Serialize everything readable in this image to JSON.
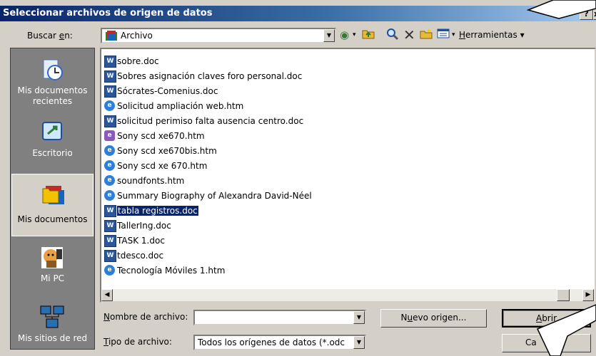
{
  "dialog": {
    "title": "Seleccionar archivos de origen de datos",
    "help_label": "?",
    "close_label": "x"
  },
  "lookin": {
    "label_pre": "Buscar ",
    "label_key": "e",
    "label_post": "n:",
    "value": "Archivo"
  },
  "toolbar": {
    "tools_key": "H",
    "tools_rest": "erramientas",
    "tools_arrow": "▾"
  },
  "places": [
    {
      "label": "Mis documentos recientes"
    },
    {
      "label": "Escritorio"
    },
    {
      "label": "Mis documentos"
    },
    {
      "label": "Mi PC"
    },
    {
      "label": "Mis sitios de red"
    }
  ],
  "files": [
    {
      "name": "sobre.doc",
      "type": "doc"
    },
    {
      "name": "Sobres asignación claves foro personal.doc",
      "type": "doc"
    },
    {
      "name": "Sócrates-Comenius.doc",
      "type": "doc"
    },
    {
      "name": "Solicitud ampliación web.htm",
      "type": "htm"
    },
    {
      "name": "solicitud perimiso falta ausencia centro.doc",
      "type": "doc"
    },
    {
      "name": "Sony scd xe670.htm",
      "type": "htm2"
    },
    {
      "name": "Sony scd xe670bis.htm",
      "type": "htm"
    },
    {
      "name": "Sony scd xe 670.htm",
      "type": "htm"
    },
    {
      "name": "soundfonts.htm",
      "type": "htm"
    },
    {
      "name": "Summary Biography of Alexandra David-Néel",
      "type": "htm"
    },
    {
      "name": "tabla registros.doc",
      "type": "doc",
      "selected": true
    },
    {
      "name": "TallerIng.doc",
      "type": "doc"
    },
    {
      "name": "TASK 1.doc",
      "type": "doc"
    },
    {
      "name": "tdesco.doc",
      "type": "doc"
    },
    {
      "name": "Tecnología Móviles 1.htm",
      "type": "htm"
    }
  ],
  "filename": {
    "label_key": "N",
    "label_rest": "ombre de archivo:",
    "value": ""
  },
  "filetype": {
    "label_key": "T",
    "label_rest": "ipo de archivo:",
    "value": "Todos los orígenes de datos (*.odc"
  },
  "buttons": {
    "new_source_pre": "N",
    "new_source_key": "u",
    "new_source_post": "evo origen...",
    "open_key": "A",
    "open_rest": "brir",
    "cancel": "Ca"
  },
  "colors": {
    "title_start": "#0a246a",
    "title_end": "#a6caf0",
    "face": "#d4d0c8",
    "selection": "#0a246a"
  }
}
